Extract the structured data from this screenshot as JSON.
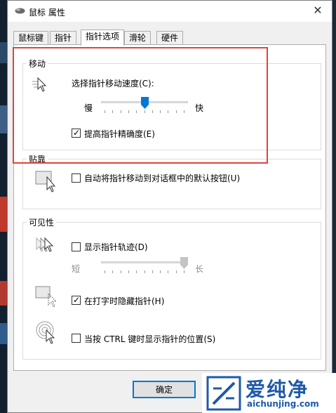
{
  "window": {
    "title": "鼠标 属性",
    "close_glyph": "✕"
  },
  "tabs": [
    {
      "label": "鼠标键"
    },
    {
      "label": "指针"
    },
    {
      "label": "指针选项",
      "active": true
    },
    {
      "label": "滑轮"
    },
    {
      "label": "硬件"
    }
  ],
  "motion": {
    "group_label": "移动",
    "speed_label": "选择指针移动速度(C):",
    "slow_label": "慢",
    "fast_label": "快",
    "speed_value_fraction": 0.5,
    "precision_label": "提高指针精确度(E)",
    "precision_checked": true
  },
  "snap": {
    "group_label": "贴靠",
    "snap_label": "自动将指针移动到对话框中的默认按钮(U)",
    "snap_checked": false
  },
  "visibility": {
    "group_label": "可见性",
    "trails_label": "显示指针轨迹(D)",
    "trails_checked": false,
    "short_label": "短",
    "long_label": "长",
    "trail_value_fraction": 1.0,
    "hide_typing_label": "在打字时隐藏指针(H)",
    "hide_typing_checked": true,
    "ctrl_label": "当按 CTRL 键时显示指针的位置(S)",
    "ctrl_checked": false
  },
  "buttons": {
    "ok_label": "确定"
  },
  "watermark": {
    "brand": "爱纯净",
    "url": "aichunjing.com"
  },
  "colors": {
    "accent": "#0078d7",
    "highlight": "#e0443c",
    "brand": "#1e5aa8"
  },
  "checkmark_glyph": "✓"
}
